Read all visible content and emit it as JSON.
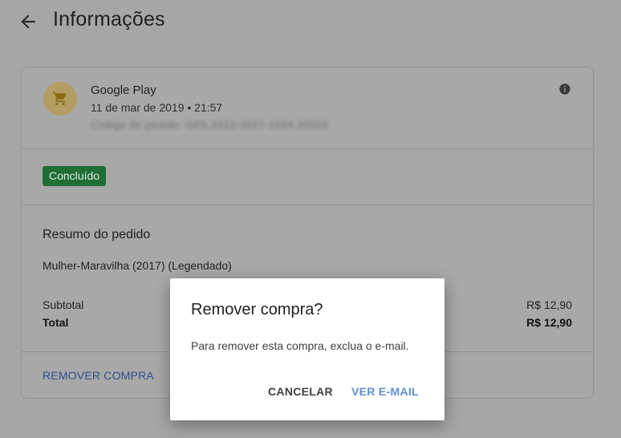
{
  "header": {
    "title": "Informações",
    "back_icon": "arrow-back-icon"
  },
  "order": {
    "merchant": "Google Play",
    "date": "11 de mar de 2019 • 21:57",
    "obscured_text": "Código do pedido: GPA.3312-0027-1824-39503",
    "merchant_icon": "shopping-cart-icon",
    "info_icon": "info-icon",
    "status": "Concluído",
    "status_color": "#1f6e36",
    "summary_title": "Resumo do pedido",
    "item": "Mulher-Maravilha (2017) (Legendado)",
    "subtotal_label": "Subtotal",
    "subtotal_value": "R$ 12,90",
    "total_label": "Total",
    "total_value": "R$ 12,90",
    "remove_label": "REMOVER COMPRA"
  },
  "dialog": {
    "title": "Remover compra?",
    "body": "Para remover esta compra, exclua o e-mail.",
    "cancel_label": "CANCELAR",
    "confirm_label": "VER E-MAIL",
    "accent_color": "#5f8fd6"
  }
}
